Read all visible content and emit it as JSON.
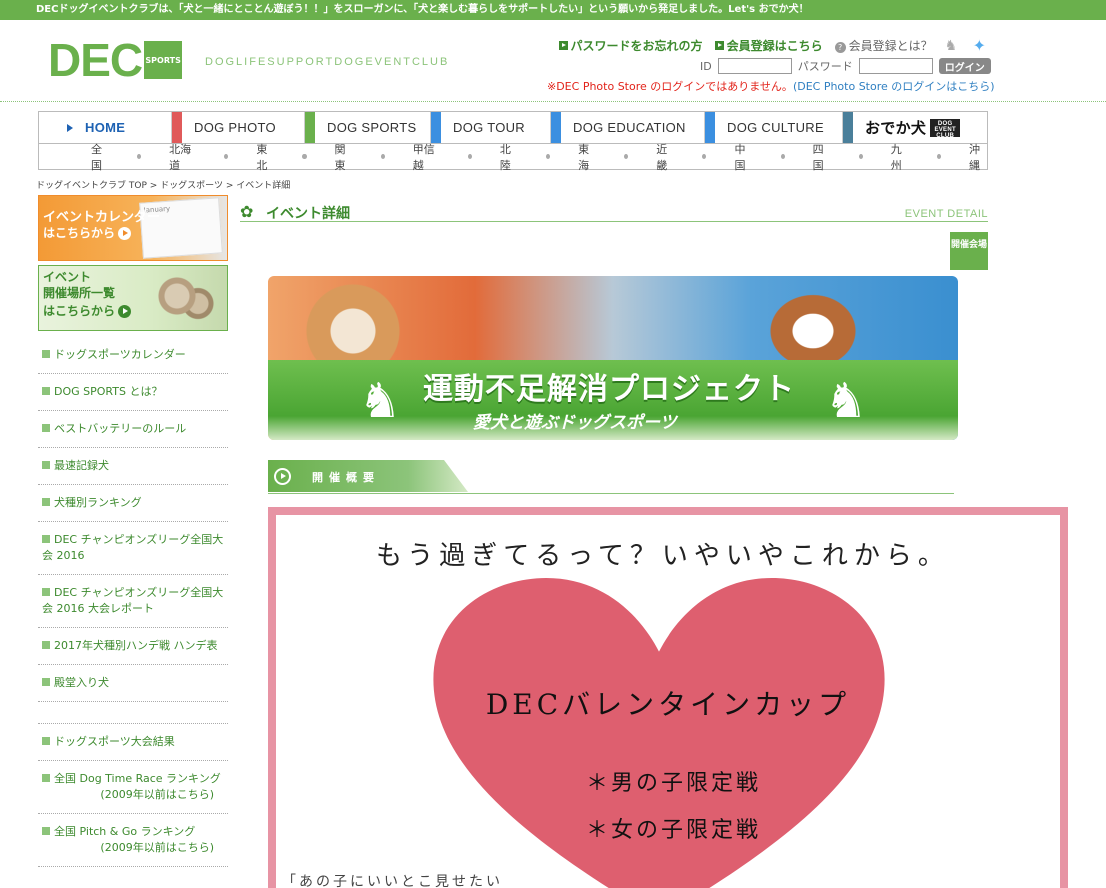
{
  "top_banner": "DECドッグイベントクラブは、「犬と一緒にとことん遊ぼう！！」をスローガンに、「犬と楽しむ暮らしをサポートしたい」という願いから発足しました。Let's おでか犬！",
  "header": {
    "logo_main": "DEC",
    "logo_sub": "SPORTS",
    "tagline": "DOGLIFESUPPORTDOGEVENTCLUB",
    "link_password": "パスワードをお忘れの方",
    "link_register": "会員登録はこちら",
    "link_about": "会員登録とは？",
    "id_label": "ID",
    "pw_label": "パスワード",
    "login_button": "ログイン",
    "note_red": "※DEC Photo Store のログインではありません。",
    "note_blue": "(DEC Photo Store のログインはこちら)"
  },
  "nav": {
    "items": [
      {
        "label": "HOME",
        "color": "#1e62b3"
      },
      {
        "label": "DOG PHOTO",
        "color": "#e05a5a"
      },
      {
        "label": "DOG SPORTS",
        "color": "#6ab04c"
      },
      {
        "label": "DOG TOUR",
        "color": "#3b8fe0"
      },
      {
        "label": "DOG EDUCATION",
        "color": "#3b8fe0"
      },
      {
        "label": "DOG CULTURE",
        "color": "#3b8fe0"
      },
      {
        "label": "おでか犬",
        "color": "#4a7f9a"
      }
    ],
    "odeka_badge": "DOG EVENT CLUB"
  },
  "regions": [
    "全国",
    "北海道",
    "東北",
    "関東",
    "甲信越",
    "北陸",
    "東海",
    "近畿",
    "中国",
    "四国",
    "九州",
    "沖縄"
  ],
  "breadcrumb": "ドッグイベントクラブ TOP > ドッグスポーツ > イベント詳細",
  "left": {
    "cal_line1": "イベントカレンダー",
    "cal_line2": "はこちらから",
    "cal_page": "January",
    "place_line1": "イベント",
    "place_line2": "開催場所一覧",
    "place_line3": "はこちらから",
    "menu": [
      {
        "label": "ドッグスポーツカレンダー"
      },
      {
        "label": "DOG SPORTS とは？"
      },
      {
        "label": "ベストバッテリーのルール"
      },
      {
        "label": "最速記録犬"
      },
      {
        "label": "犬種別ランキング"
      },
      {
        "label": "DEC チャンピオンズリーグ全国大会 2016"
      },
      {
        "label": "DEC チャンピオンズリーグ全国大会 2016 大会レポート"
      },
      {
        "label": "2017年犬種別ハンデ戦 ハンデ表"
      },
      {
        "label": "殿堂入り犬"
      },
      {
        "label": ""
      },
      {
        "label": "ドッグスポーツ大会結果"
      },
      {
        "label": "全国 Dog Time Race ランキング",
        "sub": "(2009年以前はこちら)"
      },
      {
        "label": "全国 Pitch & Go ランキング",
        "sub": "(2009年以前はこちら)"
      }
    ]
  },
  "main": {
    "section_jp": "イベント詳細",
    "section_en": "EVENT DETAIL",
    "kaijo_button": "開催会場",
    "hero_title": "運動不足解消プロジェクト",
    "hero_sub": "愛犬と遊ぶドッグスポーツ",
    "overview_label": "開催概要",
    "poster_headline": "もう過ぎてるって？いやいやこれから。",
    "poster_cup": "DECバレンタインカップ",
    "poster_line1": "＊男の子限定戦",
    "poster_line2": "＊女の子限定戦",
    "poster_bottom": "「あの子にいいとこ見せたい"
  }
}
